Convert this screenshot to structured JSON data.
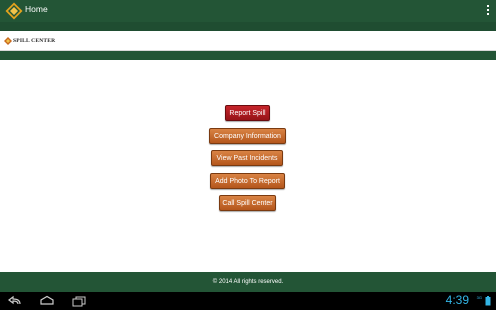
{
  "appbar": {
    "title": "Home"
  },
  "brand": {
    "name": "SPILL CENTER"
  },
  "buttons": {
    "report_spill": "Report Spill",
    "company_information": "Company Information",
    "view_past_incidents": "View Past Incidents",
    "add_photo": "Add Photo To Report",
    "call_spill_center": "Call Spill Center"
  },
  "footer": {
    "copyright": "© 2014 All rights reserved."
  },
  "system": {
    "time": "4:39",
    "signal": "3G"
  },
  "colors": {
    "primary_green": "#235536",
    "button_orange": "#c2692a",
    "button_red": "#b11d22",
    "clock_blue": "#33b5e5"
  },
  "icons": {
    "app": "spill-center-diamond-logo",
    "menu": "overflow-menu-icon",
    "back": "back-icon",
    "home": "home-icon",
    "recents": "recent-apps-icon",
    "battery": "battery-icon"
  }
}
